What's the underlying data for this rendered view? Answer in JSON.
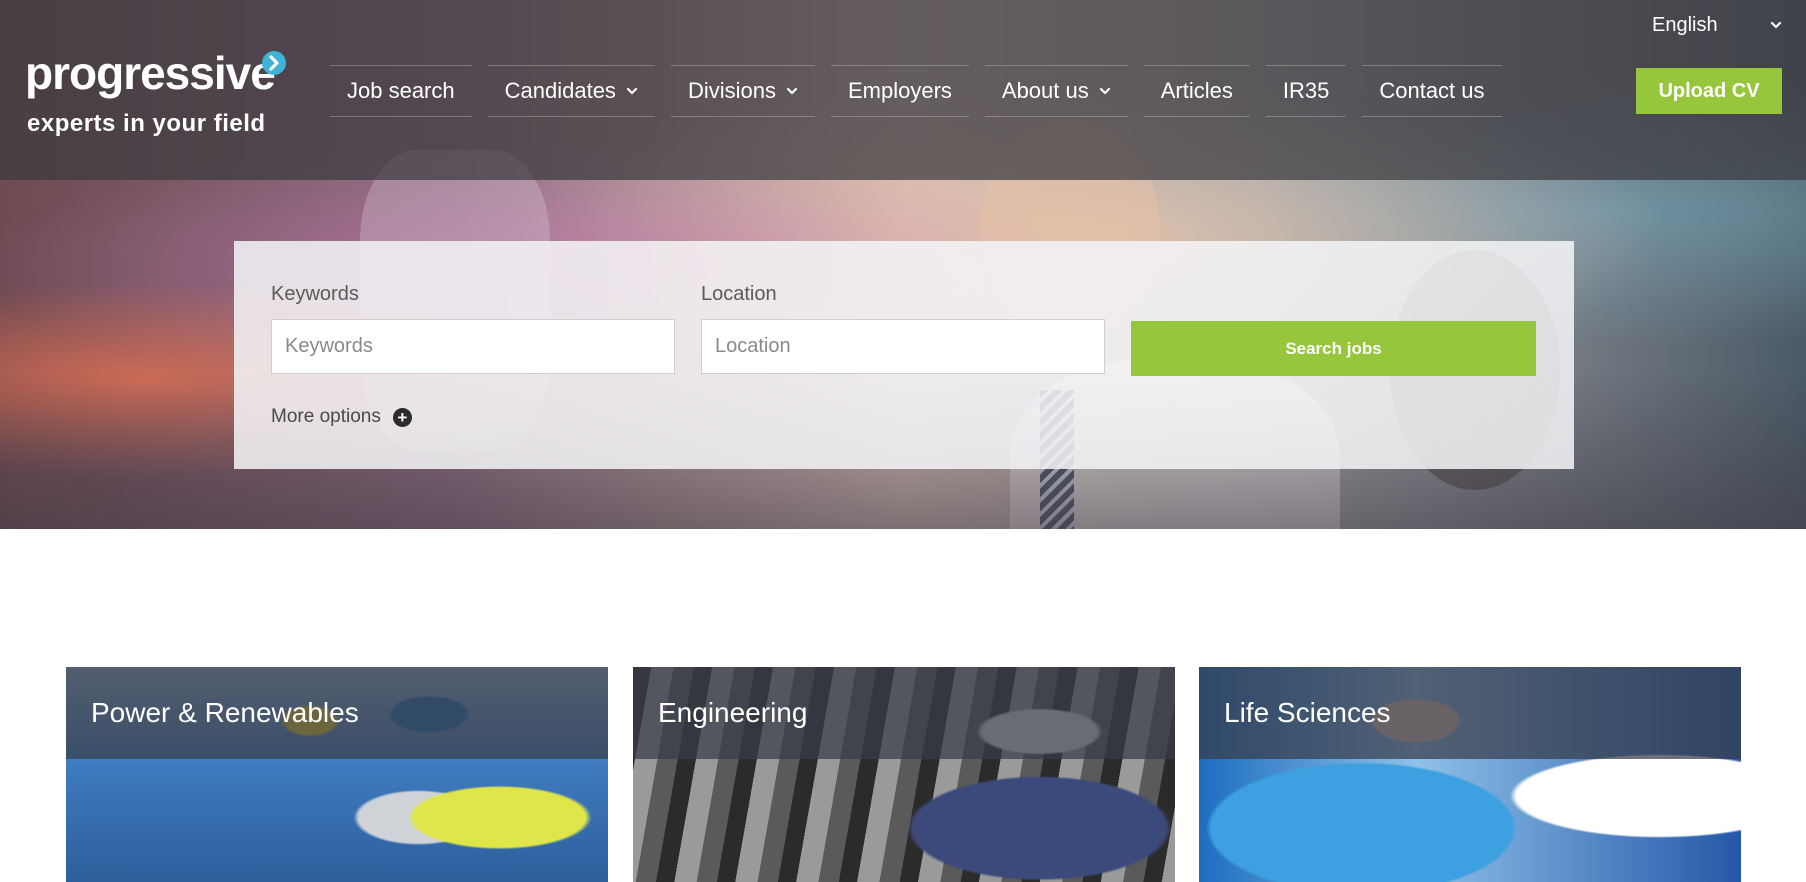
{
  "brand": {
    "name": "progressive",
    "tagline": "experts in your field",
    "accent_color": "#95c63b",
    "logo_mark_color": "#3fb4d6"
  },
  "language": {
    "selected": "English"
  },
  "nav": {
    "items": [
      {
        "label": "Job search",
        "has_dropdown": false
      },
      {
        "label": "Candidates",
        "has_dropdown": true
      },
      {
        "label": "Divisions",
        "has_dropdown": true
      },
      {
        "label": "Employers",
        "has_dropdown": false
      },
      {
        "label": "About us",
        "has_dropdown": true
      },
      {
        "label": "Articles",
        "has_dropdown": false
      },
      {
        "label": "IR35",
        "has_dropdown": false
      },
      {
        "label": "Contact us",
        "has_dropdown": false
      }
    ],
    "upload_cv_label": "Upload CV"
  },
  "search": {
    "keywords_label": "Keywords",
    "keywords_placeholder": "Keywords",
    "keywords_value": "",
    "location_label": "Location",
    "location_placeholder": "Location",
    "location_value": "",
    "button_label": "Search jobs",
    "more_options_label": "More options"
  },
  "divisions": [
    {
      "title": "Power & Renewables"
    },
    {
      "title": "Engineering"
    },
    {
      "title": "Life Sciences"
    }
  ]
}
